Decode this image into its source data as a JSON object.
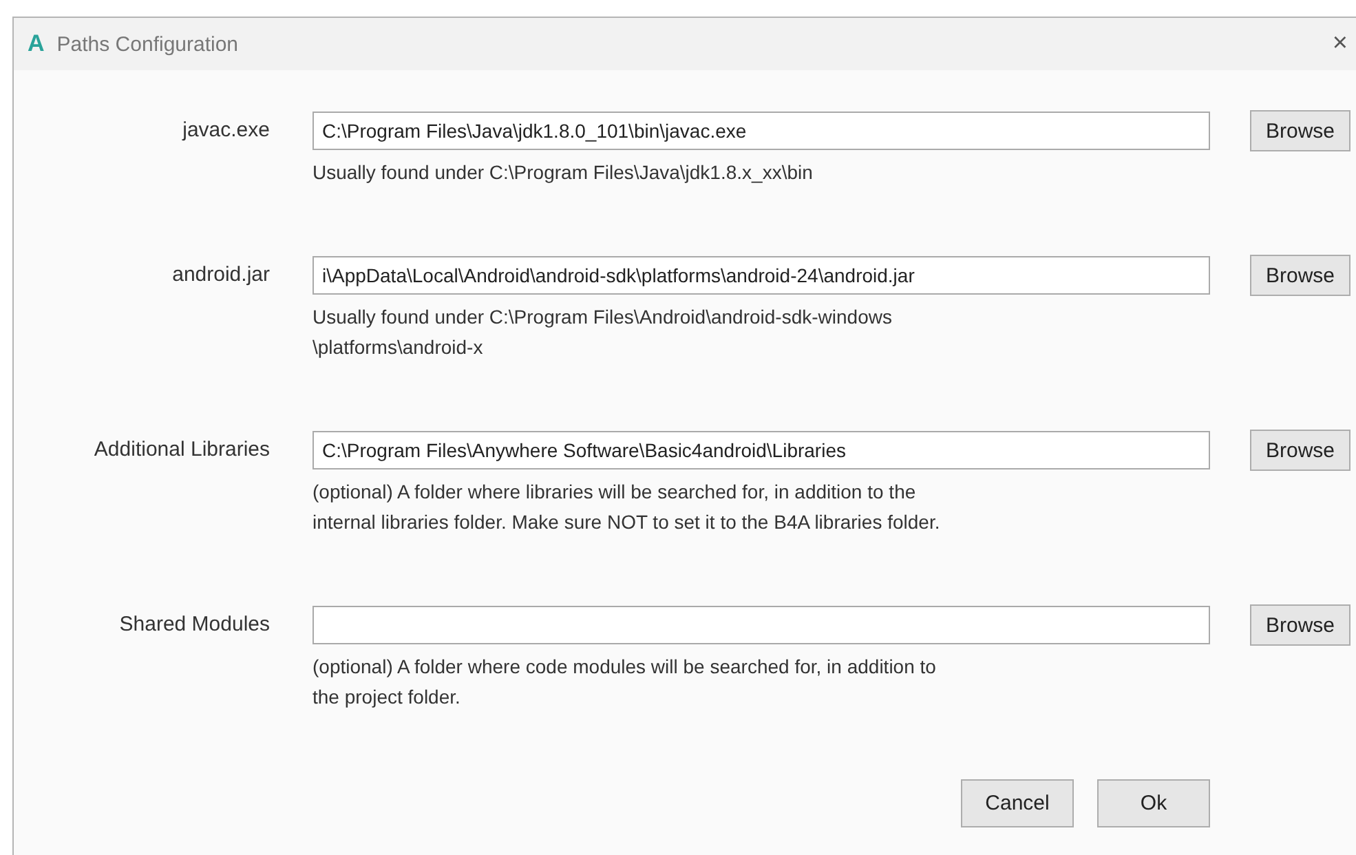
{
  "window": {
    "logo": "A",
    "title": "Paths Configuration",
    "close": "×"
  },
  "rows": [
    {
      "label": "javac.exe",
      "value": "C:\\Program Files\\Java\\jdk1.8.0_101\\bin\\javac.exe",
      "button": "Browse",
      "help": [
        "Usually found under C:\\Program Files\\Java\\jdk1.8.x_xx\\bin"
      ]
    },
    {
      "label": "android.jar",
      "value": "i\\AppData\\Local\\Android\\android-sdk\\platforms\\android-24\\android.jar",
      "button": "Browse",
      "help": [
        "Usually found under C:\\Program Files\\Android\\android-sdk-windows",
        "\\platforms\\android-x"
      ]
    },
    {
      "label": "Additional Libraries",
      "value": "C:\\Program Files\\Anywhere Software\\Basic4android\\Libraries",
      "button": "Browse",
      "help": [
        "(optional) A folder where libraries will be searched for, in addition to the",
        "internal libraries folder. Make sure NOT to set it to the B4A libraries folder."
      ]
    },
    {
      "label": "Shared Modules",
      "value": "",
      "button": "Browse",
      "help": [
        "(optional) A folder where code modules will be searched for, in addition to",
        "the project folder."
      ]
    }
  ],
  "buttons": [
    "Cancel",
    "Ok"
  ]
}
